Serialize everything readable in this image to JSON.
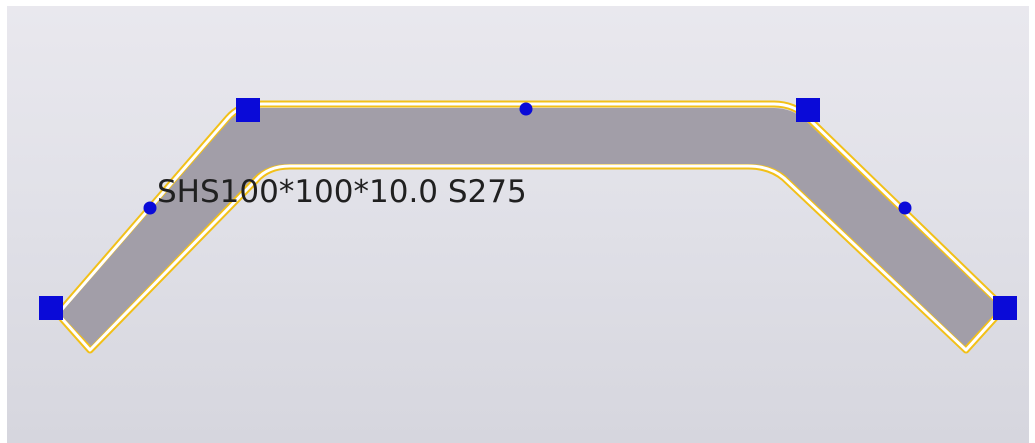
{
  "member": {
    "profile_label": "SHS100*100*10.0 S275",
    "body_color": "#a29ea8",
    "selection_outline_color": "#f2c018",
    "inner_highlight_color": "#ffffff",
    "handle_color": "#0a0ad8"
  },
  "handles": {
    "corner_handles": [
      {
        "name": "handle-end-left"
      },
      {
        "name": "handle-bend-left"
      },
      {
        "name": "handle-bend-right"
      },
      {
        "name": "handle-end-right"
      }
    ],
    "midpoint_handles": [
      {
        "name": "midpoint-left-segment"
      },
      {
        "name": "midpoint-top-segment"
      },
      {
        "name": "midpoint-right-segment"
      }
    ]
  }
}
